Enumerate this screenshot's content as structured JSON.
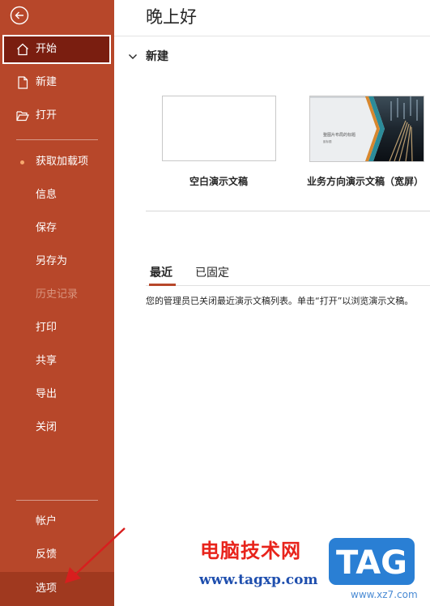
{
  "colors": {
    "accent": "#b7472a",
    "selected_bg": "#7a1e10",
    "watermark_red": "#e8231b",
    "watermark_blue": "#1f4fae",
    "tag_blue": "#2a7fd4"
  },
  "sidebar": {
    "back_icon": "arrow-left-circle-icon",
    "items": [
      {
        "label": "开始",
        "icon": "home-icon"
      },
      {
        "label": "新建",
        "icon": "document-icon"
      },
      {
        "label": "打开",
        "icon": "folder-open-icon"
      },
      {
        "label": "获取加载项"
      },
      {
        "label": "信息"
      },
      {
        "label": "保存"
      },
      {
        "label": "另存为"
      },
      {
        "label": "历史记录"
      },
      {
        "label": "打印"
      },
      {
        "label": "共享"
      },
      {
        "label": "导出"
      },
      {
        "label": "关闭"
      }
    ],
    "bottom": [
      {
        "label": "帐户"
      },
      {
        "label": "反馈"
      },
      {
        "label": "选项"
      }
    ]
  },
  "main": {
    "greeting": "晚上好",
    "new_section": "新建",
    "templates": [
      {
        "label": "空白演示文稿"
      },
      {
        "label": "业务方向演示文稿（宽屏）",
        "thumb_title": "整图片布局的标题",
        "thumb_sub": "副标题"
      }
    ],
    "tabs": [
      {
        "label": "最近"
      },
      {
        "label": "已固定"
      }
    ],
    "notice": "您的管理员已关闭最近演示文稿列表。单击“打开”以浏览演示文稿。"
  },
  "watermark": {
    "cn": "电脑技术网",
    "url": "www.tagxp.com",
    "logo": "TAG",
    "site": "www.xz7.com"
  }
}
